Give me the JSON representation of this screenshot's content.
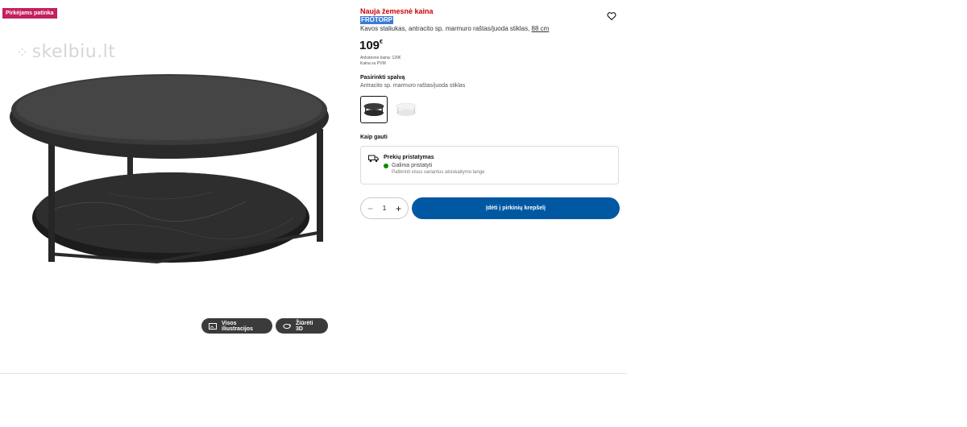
{
  "gallery": {
    "badge": "Pirkėjams patinka",
    "watermark": "skelbiu.lt",
    "illustrations_label": "Visos iliustracijos",
    "view3d_label": "Žiūrėti 3D"
  },
  "product": {
    "price_type": "Nauja žemesnė kaina",
    "name": "FRÖTORP",
    "description": "Kavos staliukas, antracito sp. marmuro raštas/juoda stiklas,",
    "size": "88 cm",
    "price_main": "109",
    "price_currency": "€",
    "previous_price": "Ankstesnė kaina: 129€",
    "vat_note": "Kaina su PVM"
  },
  "color": {
    "title": "Pasirinkti spalvą",
    "selected": "Antracito sp. marmuro raštas/juoda stiklas"
  },
  "delivery": {
    "section_title": "Kaip gauti",
    "title": "Prekių pristatymas",
    "status": "Galima pristatyti",
    "note": "Patikrinti visus variantus atsiskaitymo lange",
    "status_color": "#0a8a00"
  },
  "cart": {
    "quantity": "1",
    "add_label": "Įdėti į pirkinių krepšelį",
    "button_color": "#0058a3"
  }
}
